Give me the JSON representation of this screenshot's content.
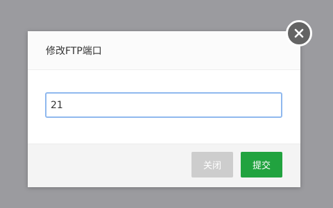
{
  "dialog": {
    "title": "修改FTP端口",
    "port_value": "21",
    "close_button_label": "关闭",
    "submit_button_label": "提交"
  },
  "icons": {
    "dismiss": "close-icon"
  },
  "colors": {
    "overlay": "#9b9b9f",
    "submit": "#21a33f",
    "close_button": "#cdcdcd",
    "input_border": "#8fb8ee"
  }
}
